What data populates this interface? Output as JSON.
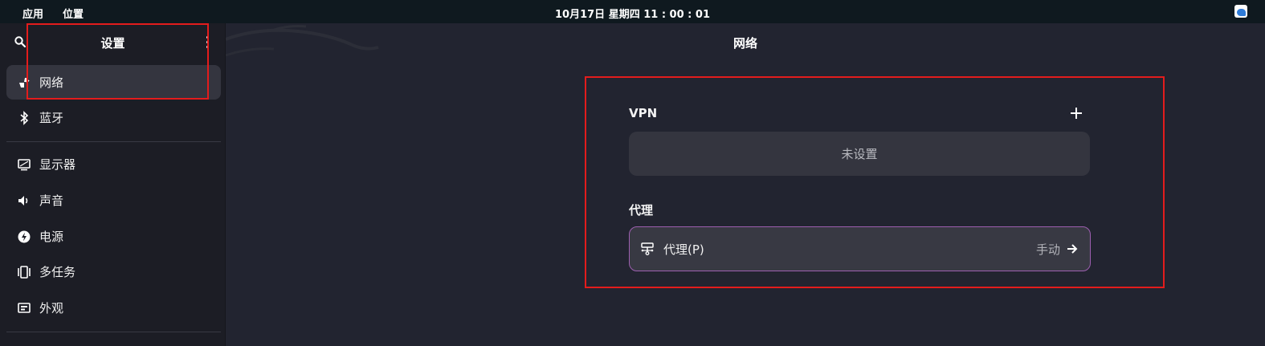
{
  "topbar": {
    "apps_menu": "应用",
    "places_menu": "位置",
    "clock": "10月17日 星期四  11 : 00 : 01",
    "tray_icon": "messenger-icon"
  },
  "sidebar": {
    "title": "设置",
    "search_icon": "search-icon",
    "menu_icon": "more-vertical-icon",
    "items": [
      {
        "label": "网络",
        "icon": "network-icon",
        "active": true
      },
      {
        "label": "蓝牙",
        "icon": "bluetooth-icon"
      },
      {
        "label": "显示器",
        "icon": "display-icon"
      },
      {
        "label": "声音",
        "icon": "sound-icon"
      },
      {
        "label": "电源",
        "icon": "power-icon"
      },
      {
        "label": "多任务",
        "icon": "multitasking-icon"
      },
      {
        "label": "外观",
        "icon": "appearance-icon"
      }
    ]
  },
  "main": {
    "title": "网络",
    "vpn": {
      "label": "VPN",
      "add_icon": "plus-icon",
      "empty_text": "未设置"
    },
    "proxy": {
      "section_label": "代理",
      "row_label": "代理(P)",
      "row_value": "手动",
      "row_icon": "proxy-icon",
      "arrow_icon": "arrow-right-icon"
    }
  },
  "colors": {
    "background": "#222430",
    "sidebar": "#1c1d25",
    "topbar": "#0f191f",
    "card": "#34353f",
    "focus_border": "#9d5fb0",
    "annotation": "#e31c1c"
  }
}
